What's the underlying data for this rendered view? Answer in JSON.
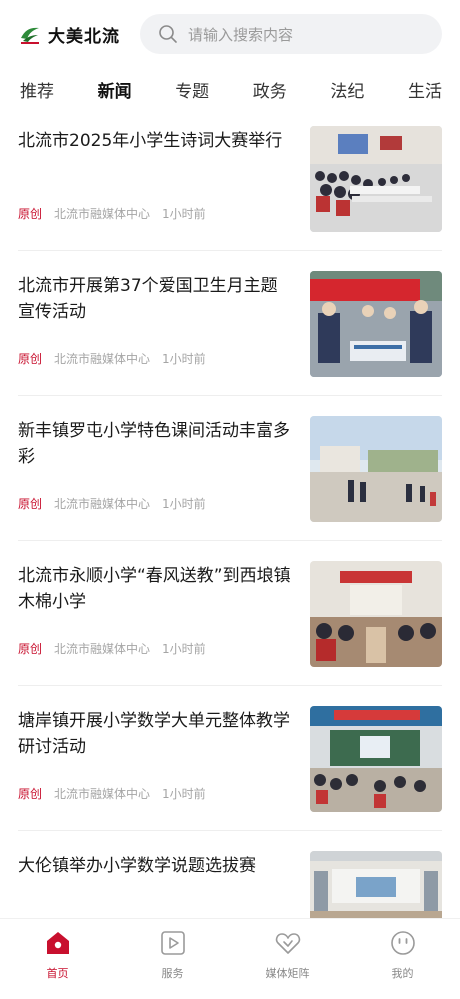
{
  "header": {
    "logo_text": "大美北流",
    "search_placeholder": "请输入搜索内容"
  },
  "tabs": [
    {
      "label": "推荐"
    },
    {
      "label": "新闻",
      "active": true
    },
    {
      "label": "专题"
    },
    {
      "label": "政务"
    },
    {
      "label": "法纪"
    },
    {
      "label": "生活"
    }
  ],
  "articles": [
    {
      "title": "北流市2025年小学生诗词大赛举行",
      "tag": "原创",
      "source": "北流市融媒体中心",
      "time": "1小时前"
    },
    {
      "title": "北流市开展第37个爱国卫生月主题宣传活动",
      "tag": "原创",
      "source": "北流市融媒体中心",
      "time": "1小时前"
    },
    {
      "title": "新丰镇罗屯小学特色课间活动丰富多彩",
      "tag": "原创",
      "source": "北流市融媒体中心",
      "time": "1小时前"
    },
    {
      "title": "北流市永顺小学“春风送教”到西埌镇木棉小学",
      "tag": "原创",
      "source": "北流市融媒体中心",
      "time": "1小时前"
    },
    {
      "title": "塘岸镇开展小学数学大单元整体教学研讨活动",
      "tag": "原创",
      "source": "北流市融媒体中心",
      "time": "1小时前"
    },
    {
      "title": "大伦镇举办小学数学说题选拔赛",
      "tag": "",
      "source": "",
      "time": ""
    }
  ],
  "bottom_nav": [
    {
      "label": "首页",
      "icon": "home-icon",
      "active": true
    },
    {
      "label": "服务",
      "icon": "play-icon"
    },
    {
      "label": "媒体矩阵",
      "icon": "heart-icon"
    },
    {
      "label": "我的",
      "icon": "profile-icon"
    }
  ],
  "colors": {
    "accent": "#c8102e",
    "muted": "#a5a5a5",
    "search_bg": "#f1f2f4"
  }
}
